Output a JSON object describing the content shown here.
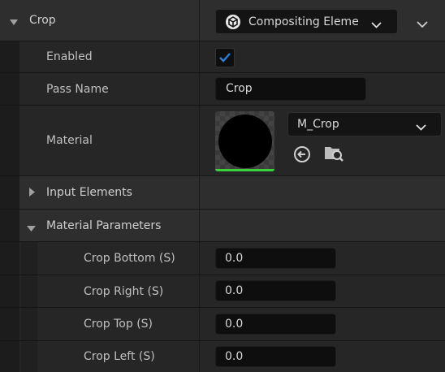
{
  "crop_section": {
    "title": "Crop",
    "type_dropdown": {
      "value": "Compositing Eleme",
      "icon": "cube-icon"
    }
  },
  "enabled": {
    "label": "Enabled",
    "checked": true
  },
  "pass_name": {
    "label": "Pass Name",
    "value": "Crop"
  },
  "material": {
    "label": "Material",
    "asset_value": "M_Crop",
    "thumbnail": "black-circle",
    "use_icon": "arrow-left-circle-icon",
    "browse_icon": "folder-search-icon"
  },
  "input_elements": {
    "label": "Input Elements",
    "expanded": false
  },
  "material_parameters": {
    "label": "Material Parameters",
    "expanded": true,
    "params": [
      {
        "label": "Crop Bottom (S)",
        "value": "0.0"
      },
      {
        "label": "Crop Right (S)",
        "value": "0.0"
      },
      {
        "label": "Crop Top (S)",
        "value": "0.0"
      },
      {
        "label": "Crop Left (S)",
        "value": "0.0"
      }
    ]
  },
  "colors": {
    "accent_blue": "#2a7fd6",
    "thumb_underline": "#3bd13b"
  }
}
